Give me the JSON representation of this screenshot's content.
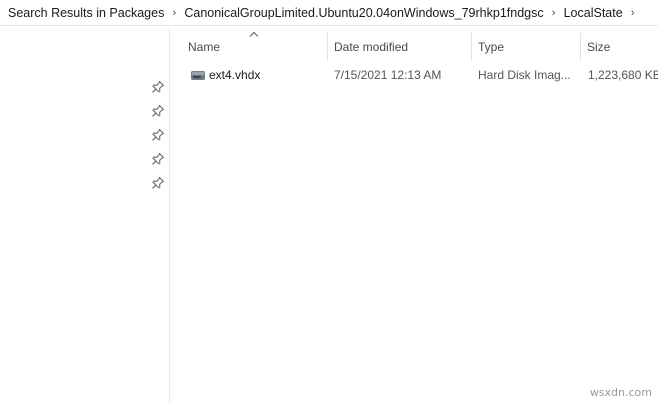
{
  "breadcrumb": {
    "items": [
      "Search Results in Packages",
      "CanonicalGroupLimited.Ubuntu20.04onWindows_79rhkp1fndgsc",
      "LocalState"
    ],
    "separator_icon": "chevron-right-icon"
  },
  "nav": {
    "pin_icon": "pin-icon",
    "pin_count": 5
  },
  "columns": {
    "name": "Name",
    "date_modified": "Date modified",
    "type": "Type",
    "size": "Size",
    "sort_icon": "sort-ascending-icon"
  },
  "files": [
    {
      "icon": "hard-disk-image-icon",
      "name": "ext4.vhdx",
      "date_modified": "7/15/2021 12:13 AM",
      "type": "Hard Disk Imag...",
      "size": "1,223,680 KB"
    }
  ],
  "watermark": "wsxdn.com"
}
